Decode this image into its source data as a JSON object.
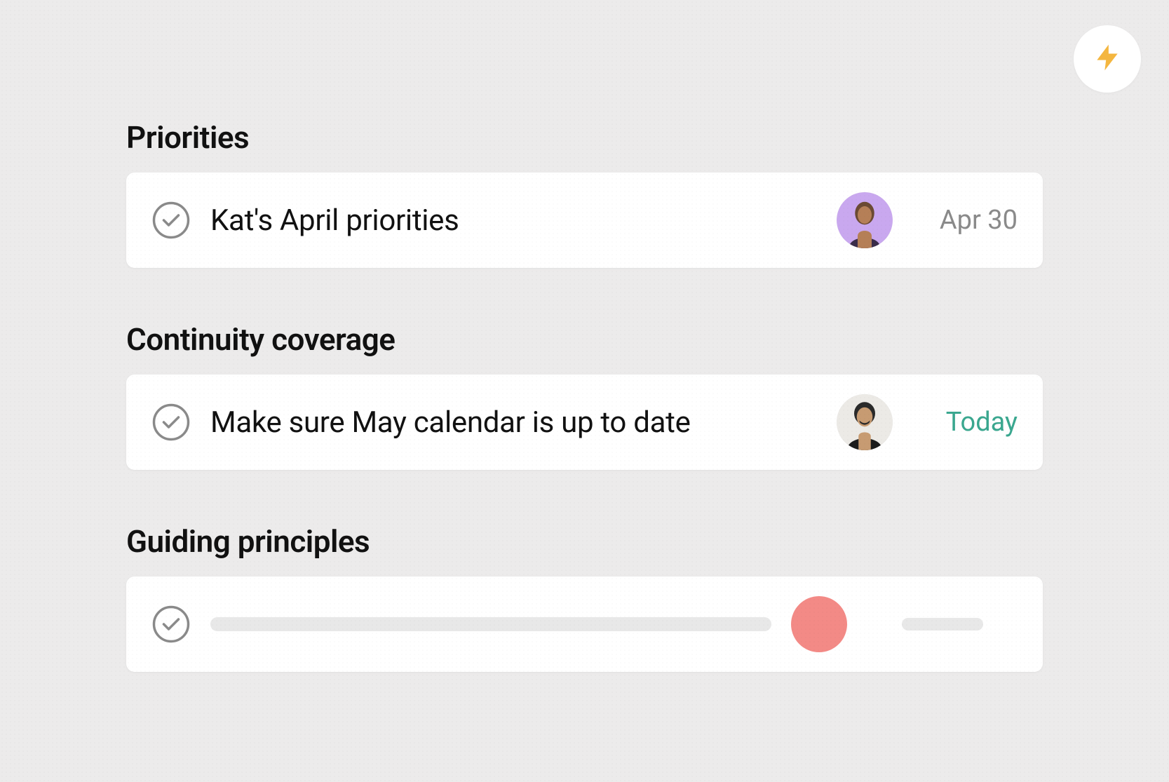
{
  "lightning_icon": "lightning-icon",
  "sections": [
    {
      "title": "Priorities",
      "task": {
        "title": "Kat's April priorities",
        "assignee_avatar_bg": "#b98cf0",
        "due": "Apr 30",
        "due_class": "gray"
      }
    },
    {
      "title": "Continuity coverage",
      "task": {
        "title": "Make sure May calendar is up to date",
        "assignee_avatar_bg": "#e4e4e4",
        "due": "Today",
        "due_class": "green"
      }
    },
    {
      "title": "Guiding principles",
      "task": {
        "title": "",
        "assignee_avatar_bg": "#f38a86",
        "due": "",
        "due_class": "placeholder",
        "placeholder": true
      }
    }
  ]
}
